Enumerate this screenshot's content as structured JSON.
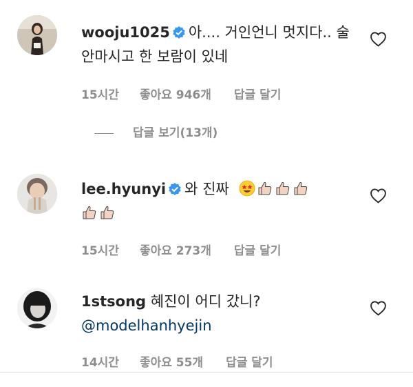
{
  "comments": [
    {
      "username": "wooju1025",
      "text": "아.... 거인언니 멋지다.. 술 안마시고 한 보람이 있네",
      "time": "15시간",
      "likes": "좋아요 946개",
      "reply": "답글 달기"
    },
    {
      "username": "lee.hyunyi",
      "text": "와 진짜",
      "time": "15시간",
      "likes": "좋아요 273개",
      "reply": "답글 달기"
    },
    {
      "username": "1stsong",
      "text": "혜진이 어디 갔니?",
      "mention": "@modelhanhyejin",
      "time": "14시간",
      "likes": "좋아요 55개",
      "reply": "답글 달기"
    }
  ],
  "view_replies": "답글 보기(13개)",
  "icons": {
    "heart": "heart-outline-icon",
    "verified": "verified-badge-icon",
    "emoji_face": "star-struck-emoji",
    "emoji_thumb": "thumbs-up-emoji"
  },
  "colors": {
    "verified": "#3897f0",
    "meta": "#8e8e8e",
    "mention": "#003569"
  }
}
